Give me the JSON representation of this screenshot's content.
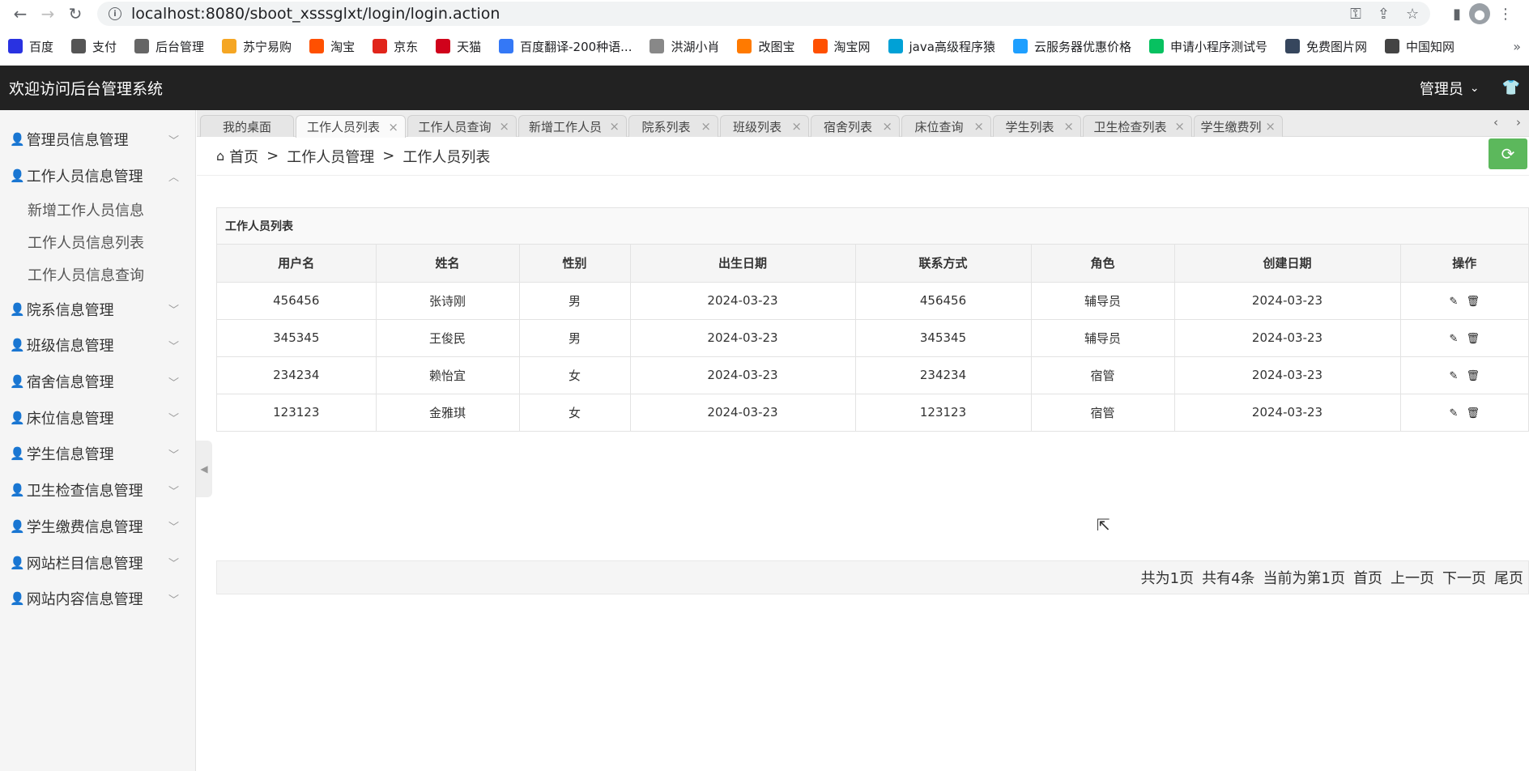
{
  "browser": {
    "url": "localhost:8080/sboot_xsssglxt/login/login.action",
    "bookmarks": [
      {
        "label": "百度",
        "icon": "paw-icon",
        "color": "#2932e1"
      },
      {
        "label": "支付",
        "icon": "pay-icon",
        "color": "#555555"
      },
      {
        "label": "后台管理",
        "icon": "globe-icon",
        "color": "#666666"
      },
      {
        "label": "苏宁易购",
        "icon": "lion-icon",
        "color": "#f5a623"
      },
      {
        "label": "淘宝",
        "icon": "taobao-icon",
        "color": "#ff5000"
      },
      {
        "label": "京东",
        "icon": "jd-icon",
        "color": "#e1251b"
      },
      {
        "label": "天猫",
        "icon": "tmall-icon",
        "color": "#d0021b"
      },
      {
        "label": "百度翻译-200种语...",
        "icon": "translate-icon",
        "color": "#3478f6"
      },
      {
        "label": "洪湖小肖",
        "icon": "bird-icon",
        "color": "#888888"
      },
      {
        "label": "改图宝",
        "icon": "gaitubao-icon",
        "color": "#ff7a00"
      },
      {
        "label": "淘宝网",
        "icon": "taobao-icon",
        "color": "#ff5000"
      },
      {
        "label": "java高级程序猿",
        "icon": "bilibili-icon",
        "color": "#00a1d6"
      },
      {
        "label": "云服务器优惠价格",
        "icon": "cloud-icon",
        "color": "#1e9fff"
      },
      {
        "label": "申请小程序测试号",
        "icon": "wechat-icon",
        "color": "#07c160"
      },
      {
        "label": "免费图片网",
        "icon": "tumblr-icon",
        "color": "#36465d"
      },
      {
        "label": "中国知网",
        "icon": "cnki-icon",
        "color": "#444444"
      }
    ]
  },
  "header": {
    "title": "欢迎访问后台管理系统",
    "user": "管理员"
  },
  "sidebar": {
    "items": [
      {
        "label": "管理员信息管理"
      },
      {
        "label": "工作人员信息管理",
        "expanded": true,
        "children": [
          {
            "label": "新增工作人员信息"
          },
          {
            "label": "工作人员信息列表"
          },
          {
            "label": "工作人员信息查询"
          }
        ]
      },
      {
        "label": "院系信息管理"
      },
      {
        "label": "班级信息管理"
      },
      {
        "label": "宿舍信息管理"
      },
      {
        "label": "床位信息管理"
      },
      {
        "label": "学生信息管理"
      },
      {
        "label": "卫生检查信息管理"
      },
      {
        "label": "学生缴费信息管理"
      },
      {
        "label": "网站栏目信息管理"
      },
      {
        "label": "网站内容信息管理"
      }
    ]
  },
  "tabs": [
    {
      "label": "我的桌面",
      "closable": false
    },
    {
      "label": "工作人员列表",
      "active": true
    },
    {
      "label": "工作人员查询"
    },
    {
      "label": "新增工作人员"
    },
    {
      "label": "院系列表"
    },
    {
      "label": "班级列表"
    },
    {
      "label": "宿舍列表"
    },
    {
      "label": "床位查询"
    },
    {
      "label": "学生列表"
    },
    {
      "label": "卫生检查列表"
    },
    {
      "label": "学生缴费列"
    }
  ],
  "breadcrumb": {
    "home": "首页",
    "level1": "工作人员管理",
    "level2": "工作人员列表"
  },
  "panel": {
    "title": "工作人员列表",
    "columns": [
      "用户名",
      "姓名",
      "性别",
      "出生日期",
      "联系方式",
      "角色",
      "创建日期",
      "操作"
    ],
    "rows": [
      [
        "456456",
        "张诗刚",
        "男",
        "2024-03-23",
        "456456",
        "辅导员",
        "2024-03-23"
      ],
      [
        "345345",
        "王俊民",
        "男",
        "2024-03-23",
        "345345",
        "辅导员",
        "2024-03-23"
      ],
      [
        "234234",
        "赖怡宜",
        "女",
        "2024-03-23",
        "234234",
        "宿管",
        "2024-03-23"
      ],
      [
        "123123",
        "金雅琪",
        "女",
        "2024-03-23",
        "123123",
        "宿管",
        "2024-03-23"
      ]
    ]
  },
  "pager": {
    "total_pages": "共为1页",
    "total_records": "共有4条",
    "current": "当前为第1页",
    "first": "首页",
    "prev": "上一页",
    "next": "下一页",
    "last": "尾页"
  }
}
